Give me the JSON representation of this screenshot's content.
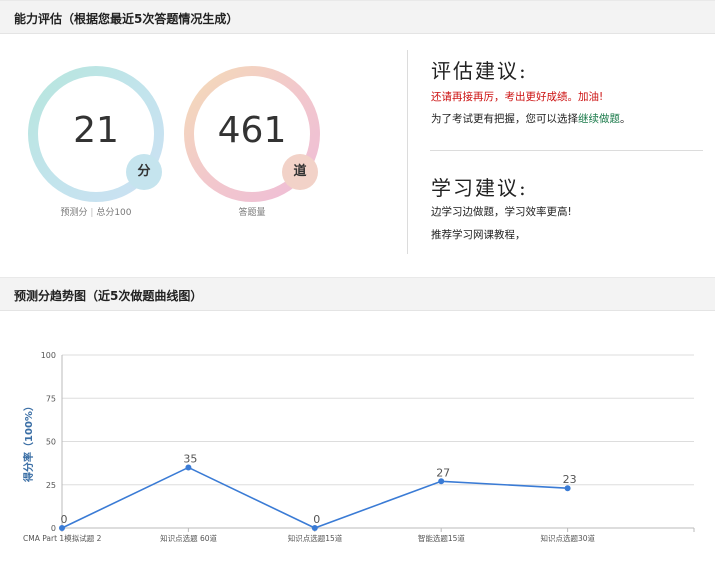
{
  "ability": {
    "title": "能力评估（根据您最近5次答题情况生成）",
    "score": {
      "value": "21",
      "unit": "分",
      "caption_left": "预测分",
      "caption_sep": "|",
      "caption_right": "总分100"
    },
    "questions": {
      "value": "461",
      "unit": "道",
      "caption": "答题量"
    }
  },
  "assessment": {
    "title": "评估建议:",
    "line1": "还请再接再厉，考出更好成绩。加油!",
    "line2_prefix": "为了考试更有把握，您可以选择",
    "line2_link": "继续做题",
    "line2_suffix": "。"
  },
  "study": {
    "title": "学习建议:",
    "line1": "边学习边做题，学习效率更高!",
    "line2": "推荐学习网课教程，"
  },
  "trend": {
    "title": "预测分趋势图（近5次做题曲线图）"
  },
  "colors": {
    "line": "#3a7bd5",
    "grid": "#dddddd"
  },
  "chart_data": {
    "type": "line",
    "ylabel": "得分率（100%）",
    "ylim": [
      0,
      100
    ],
    "yticks": [
      0,
      25,
      50,
      75,
      100
    ],
    "categories": [
      "CMA Part 1模拟试题 2",
      "知识点选题 60道",
      "知识点选题15道",
      "智能选题15道",
      "知识点选题30道"
    ],
    "values": [
      0,
      35,
      0,
      27,
      23
    ],
    "grid": true
  }
}
